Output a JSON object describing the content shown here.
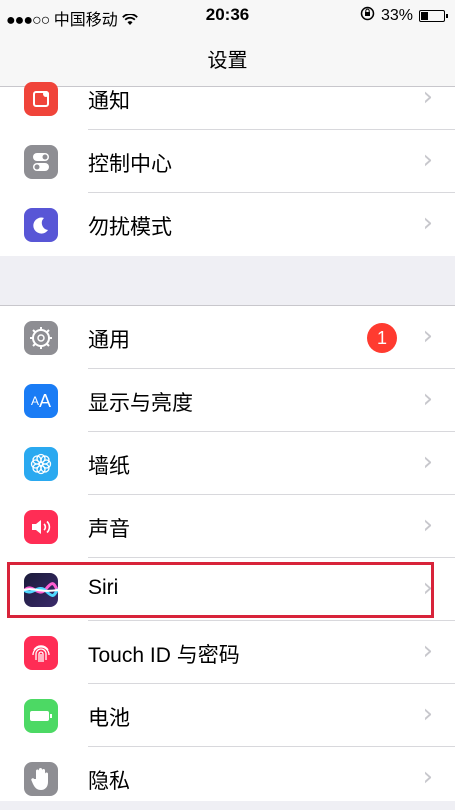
{
  "status_bar": {
    "signal": "●●●○○",
    "carrier": "中国移动",
    "time": "20:36",
    "battery_percent": "33%",
    "battery_level": 0.33
  },
  "nav": {
    "title": "设置"
  },
  "group1": [
    {
      "label": "通知",
      "icon": "notifications-icon",
      "color": "#f0443a"
    },
    {
      "label": "控制中心",
      "icon": "control-center-icon",
      "color": "#8e8e93"
    },
    {
      "label": "勿扰模式",
      "icon": "moon-icon",
      "color": "#5856d6"
    }
  ],
  "group2": [
    {
      "label": "通用",
      "icon": "gear-icon",
      "color": "#8e8e93",
      "badge": "1"
    },
    {
      "label": "显示与亮度",
      "icon": "display-icon",
      "color": "#1a7cf5",
      "glyph": "AA"
    },
    {
      "label": "墙纸",
      "icon": "wallpaper-icon",
      "color": "#2aa9f0"
    },
    {
      "label": "声音",
      "icon": "sound-icon",
      "color": "#ff2d55"
    },
    {
      "label": "Siri",
      "icon": "siri-icon",
      "color": "#202040"
    },
    {
      "label": "Touch ID 与密码",
      "icon": "fingerprint-icon",
      "color": "#ff2d55"
    },
    {
      "label": "电池",
      "icon": "battery-icon",
      "color": "#4cd964"
    },
    {
      "label": "隐私",
      "icon": "hand-icon",
      "color": "#8e8e93"
    }
  ]
}
